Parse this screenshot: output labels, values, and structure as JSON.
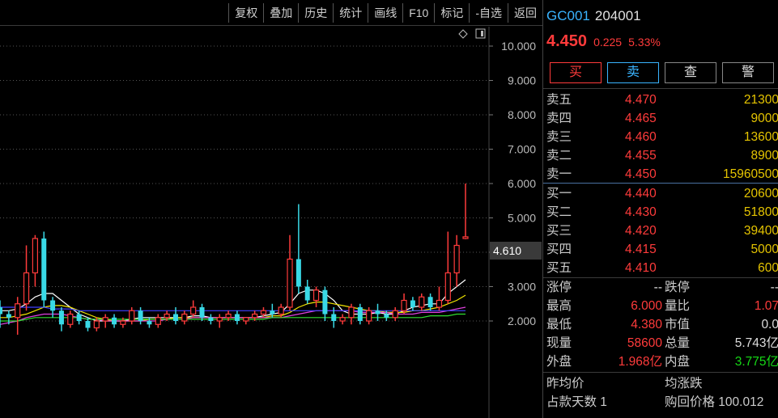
{
  "toolbar": {
    "buttons": [
      "复权",
      "叠加",
      "历史",
      "统计",
      "画线",
      "F10",
      "标记",
      "-自选",
      "返回"
    ]
  },
  "chart": {
    "y_ticks": [
      "10.000",
      "9.000",
      "8.000",
      "7.000",
      "6.000",
      "5.000",
      "4.000",
      "3.000",
      "2.000"
    ],
    "last_price_tag": "4.610",
    "colors": {
      "up": "#ff3b3b",
      "down": "#39d9e6",
      "ma1": "#ffffff",
      "ma2": "#f2e600",
      "ma3": "#e040e0",
      "ma4": "#30e030",
      "ma5": "#4040ff"
    }
  },
  "chart_data": {
    "type": "candlestick",
    "ylim": [
      1.0,
      10.5
    ],
    "y_ticks": [
      10,
      9,
      8,
      7,
      6,
      5,
      4,
      3,
      2
    ],
    "candles": [
      [
        2.4,
        2.6,
        1.8,
        2.2
      ],
      [
        2.2,
        2.3,
        1.9,
        2.1
      ],
      [
        2.1,
        2.7,
        1.6,
        2.5
      ],
      [
        2.5,
        4.2,
        2.3,
        3.4
      ],
      [
        3.4,
        4.5,
        3.0,
        4.4
      ],
      [
        4.4,
        4.6,
        2.4,
        2.6
      ],
      [
        2.6,
        2.7,
        2.1,
        2.3
      ],
      [
        2.3,
        2.4,
        1.7,
        1.9
      ],
      [
        1.9,
        2.3,
        1.8,
        2.2
      ],
      [
        2.2,
        2.3,
        1.9,
        2.0
      ],
      [
        2.0,
        2.1,
        1.7,
        1.8
      ],
      [
        1.8,
        2.1,
        1.7,
        2.0
      ],
      [
        2.0,
        2.2,
        1.8,
        2.1
      ],
      [
        2.1,
        2.2,
        1.8,
        1.9
      ],
      [
        1.9,
        2.1,
        1.8,
        2.0
      ],
      [
        2.0,
        2.4,
        1.9,
        2.3
      ],
      [
        2.3,
        2.4,
        1.9,
        2.0
      ],
      [
        2.0,
        2.1,
        1.8,
        1.9
      ],
      [
        1.9,
        2.2,
        1.8,
        2.1
      ],
      [
        2.1,
        2.3,
        2.0,
        2.2
      ],
      [
        2.2,
        2.4,
        1.9,
        2.0
      ],
      [
        2.0,
        2.3,
        1.9,
        2.2
      ],
      [
        2.2,
        2.6,
        2.1,
        2.4
      ],
      [
        2.4,
        2.5,
        2.0,
        2.1
      ],
      [
        2.1,
        2.2,
        1.9,
        2.0
      ],
      [
        2.0,
        2.2,
        1.8,
        2.1
      ],
      [
        2.1,
        2.3,
        2.0,
        2.2
      ],
      [
        2.2,
        2.3,
        1.9,
        2.0
      ],
      [
        2.0,
        2.1,
        1.9,
        2.1
      ],
      [
        2.1,
        2.3,
        2.0,
        2.2
      ],
      [
        2.2,
        2.4,
        2.1,
        2.3
      ],
      [
        2.3,
        2.5,
        2.1,
        2.2
      ],
      [
        2.2,
        2.5,
        2.1,
        2.4
      ],
      [
        2.4,
        4.5,
        2.3,
        3.8
      ],
      [
        3.8,
        5.4,
        2.8,
        3.0
      ],
      [
        3.0,
        3.2,
        2.5,
        2.6
      ],
      [
        2.6,
        3.0,
        2.4,
        2.9
      ],
      [
        2.9,
        3.0,
        2.0,
        2.2
      ],
      [
        2.2,
        2.4,
        1.8,
        2.0
      ],
      [
        2.0,
        2.2,
        1.9,
        2.1
      ],
      [
        2.1,
        2.5,
        1.9,
        2.4
      ],
      [
        2.4,
        2.5,
        1.9,
        2.0
      ],
      [
        2.0,
        2.4,
        1.9,
        2.3
      ],
      [
        2.3,
        2.5,
        2.0,
        2.2
      ],
      [
        2.2,
        2.3,
        2.0,
        2.1
      ],
      [
        2.1,
        2.4,
        2.0,
        2.3
      ],
      [
        2.3,
        2.8,
        2.2,
        2.6
      ],
      [
        2.6,
        2.7,
        2.3,
        2.4
      ],
      [
        2.4,
        2.8,
        2.3,
        2.7
      ],
      [
        2.7,
        2.8,
        2.3,
        2.4
      ],
      [
        2.4,
        3.0,
        2.3,
        2.6
      ],
      [
        2.6,
        4.6,
        2.5,
        3.4
      ],
      [
        3.4,
        4.5,
        3.0,
        4.2
      ],
      [
        4.4,
        6.0,
        4.38,
        4.45
      ]
    ],
    "ma_series": [
      {
        "values": [
          2.3,
          2.3,
          2.35,
          2.5,
          2.7,
          2.8,
          2.8,
          2.6,
          2.4,
          2.2,
          2.1,
          2.0,
          2.0,
          2.0,
          2.0,
          2.05,
          2.1,
          2.1,
          2.1,
          2.1,
          2.1,
          2.1,
          2.15,
          2.15,
          2.1,
          2.1,
          2.1,
          2.1,
          2.1,
          2.1,
          2.15,
          2.2,
          2.25,
          2.5,
          2.8,
          2.9,
          2.9,
          2.8,
          2.6,
          2.3,
          2.2,
          2.2,
          2.2,
          2.25,
          2.2,
          2.2,
          2.3,
          2.4,
          2.45,
          2.5,
          2.5,
          2.8,
          3.0,
          3.2
        ]
      },
      {
        "values": [
          2.1,
          2.1,
          2.15,
          2.2,
          2.3,
          2.4,
          2.45,
          2.45,
          2.4,
          2.3,
          2.2,
          2.1,
          2.05,
          2.0,
          2.0,
          2.0,
          2.0,
          2.05,
          2.05,
          2.05,
          2.1,
          2.1,
          2.1,
          2.1,
          2.1,
          2.1,
          2.1,
          2.1,
          2.1,
          2.1,
          2.1,
          2.15,
          2.15,
          2.25,
          2.4,
          2.5,
          2.55,
          2.55,
          2.5,
          2.45,
          2.4,
          2.35,
          2.3,
          2.3,
          2.25,
          2.25,
          2.25,
          2.3,
          2.3,
          2.35,
          2.4,
          2.5,
          2.6,
          2.75
        ]
      },
      {
        "values": [
          1.9,
          1.95,
          2.0,
          2.1,
          2.15,
          2.2,
          2.2,
          2.2,
          2.15,
          2.1,
          2.05,
          2.05,
          2.0,
          2.0,
          2.0,
          2.0,
          2.0,
          2.0,
          2.0,
          2.05,
          2.05,
          2.05,
          2.1,
          2.1,
          2.1,
          2.1,
          2.1,
          2.1,
          2.1,
          2.1,
          2.1,
          2.1,
          2.1,
          2.15,
          2.2,
          2.25,
          2.3,
          2.3,
          2.3,
          2.3,
          2.3,
          2.25,
          2.25,
          2.25,
          2.25,
          2.2,
          2.2,
          2.2,
          2.25,
          2.25,
          2.25,
          2.3,
          2.35,
          2.4
        ]
      },
      {
        "values": [
          2.0,
          2.0,
          2.0,
          2.05,
          2.1,
          2.1,
          2.1,
          2.1,
          2.1,
          2.1,
          2.05,
          2.05,
          2.05,
          2.05,
          2.05,
          2.05,
          2.05,
          2.05,
          2.05,
          2.05,
          2.05,
          2.05,
          2.05,
          2.05,
          2.05,
          2.05,
          2.05,
          2.05,
          2.05,
          2.05,
          2.05,
          2.1,
          2.1,
          2.1,
          2.1,
          2.1,
          2.1,
          2.1,
          2.1,
          2.1,
          2.1,
          2.1,
          2.1,
          2.1,
          2.1,
          2.1,
          2.1,
          2.1,
          2.1,
          2.15,
          2.15,
          2.15,
          2.2,
          2.2
        ]
      },
      {
        "values": [
          2.4,
          2.4,
          2.4,
          2.4,
          2.4,
          2.4,
          2.35,
          2.35,
          2.35,
          2.3,
          2.3,
          2.3,
          2.3,
          2.3,
          2.3,
          2.3,
          2.3,
          2.3,
          2.3,
          2.3,
          2.3,
          2.3,
          2.3,
          2.3,
          2.3,
          2.3,
          2.3,
          2.3,
          2.3,
          2.3,
          2.3,
          2.3,
          2.3,
          2.3,
          2.3,
          2.3,
          2.3,
          2.3,
          2.3,
          2.3,
          2.3,
          2.3,
          2.3,
          2.3,
          2.3,
          2.3,
          2.3,
          2.3,
          2.3,
          2.3,
          2.3,
          2.3,
          2.3,
          2.3
        ]
      }
    ]
  },
  "quote": {
    "code": "GC001",
    "name": "204001",
    "price": "4.450",
    "change": "0.225",
    "change_pct": "5.33%",
    "actions": [
      "买",
      "卖",
      "查",
      "警"
    ],
    "asks": [
      {
        "label": "卖五",
        "price": "4.470",
        "vol": "21300"
      },
      {
        "label": "卖四",
        "price": "4.465",
        "vol": "9000"
      },
      {
        "label": "卖三",
        "price": "4.460",
        "vol": "13600"
      },
      {
        "label": "卖二",
        "price": "4.455",
        "vol": "8900"
      },
      {
        "label": "卖一",
        "price": "4.450",
        "vol": "15960500"
      }
    ],
    "bids": [
      {
        "label": "买一",
        "price": "4.440",
        "vol": "20600"
      },
      {
        "label": "买二",
        "price": "4.430",
        "vol": "51800"
      },
      {
        "label": "买三",
        "price": "4.420",
        "vol": "39400"
      },
      {
        "label": "买四",
        "price": "4.415",
        "vol": "5000"
      },
      {
        "label": "买五",
        "price": "4.410",
        "vol": "600"
      }
    ],
    "stats": [
      {
        "l1": "涨停",
        "v1": "--",
        "l2": "跌停",
        "v2": "--"
      },
      {
        "l1": "最高",
        "v1": "6.000",
        "l2": "量比",
        "v2": "1.07"
      },
      {
        "l1": "最低",
        "v1": "4.380",
        "l2": "市值",
        "v2": "0.0"
      },
      {
        "l1": "现量",
        "v1": "58600",
        "l2": "总量",
        "v2": "5.743亿"
      },
      {
        "l1": "外盘",
        "v1": "1.968亿",
        "l2": "内盘",
        "v2": "3.775亿"
      }
    ],
    "misc": [
      {
        "a": "昨均价",
        "b": "均涨跌"
      },
      {
        "a": "占款天数 1",
        "b": "购回价格 100.012"
      }
    ]
  }
}
